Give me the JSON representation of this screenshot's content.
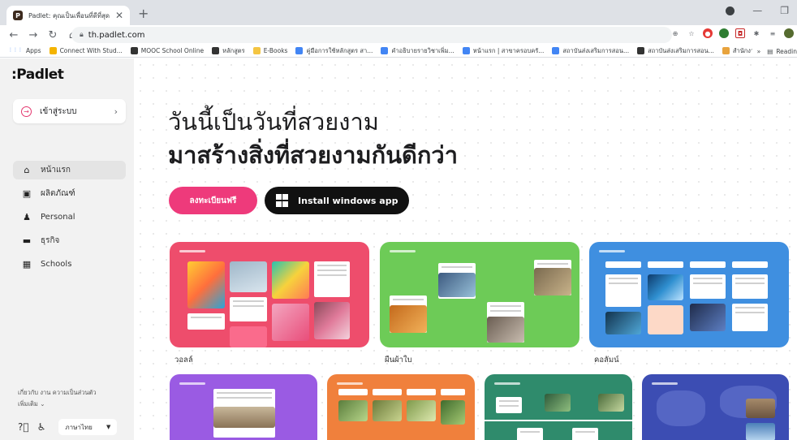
{
  "browser": {
    "tab_title": "Padlet: คุณเป็นเพื่อนที่ดีที่สุด",
    "new_tab": "+",
    "url": "th.padlet.com",
    "bookmarks": [
      {
        "label": "Apps",
        "color": "#4285f4"
      },
      {
        "label": "Connect With Stud...",
        "color": "#f4b400"
      },
      {
        "label": "MOOC School Online",
        "color": "#333333"
      },
      {
        "label": "หลักสูตร",
        "color": "#333333"
      },
      {
        "label": "E-Books",
        "color": "#f4c542"
      },
      {
        "label": "คู่มือการใช้หลักสูตร สา...",
        "color": "#4285f4"
      },
      {
        "label": "คำอธิบายรายวิชาเพิ่ม...",
        "color": "#4285f4"
      },
      {
        "label": "หน้าแรก | สาขาครอบครั...",
        "color": "#4285f4"
      },
      {
        "label": "สถาบันส่งเสริมการสอน...",
        "color": "#4285f4"
      },
      {
        "label": "สถาบันส่งเสริมการสอน...",
        "color": "#333333"
      },
      {
        "label": "สำนักงานวิชาการและ...",
        "color": "#e8a33d"
      }
    ],
    "bookmarks_more": "»",
    "reading_list": "Readin"
  },
  "sidebar": {
    "logo": ":Padlet",
    "login_label": "เข้าสู่ระบบ",
    "nav": [
      {
        "label": "หน้าแรก",
        "icon": "home-icon",
        "glyph": "⌂",
        "active": true
      },
      {
        "label": "ผลิตภัณฑ์",
        "icon": "school-hat-icon",
        "glyph": "▣",
        "active": false
      },
      {
        "label": "Personal",
        "icon": "person-icon",
        "glyph": "♟",
        "active": false
      },
      {
        "label": "ธุรกิจ",
        "icon": "briefcase-icon",
        "glyph": "▬",
        "active": false
      },
      {
        "label": "Schools",
        "icon": "schools-icon",
        "glyph": "▦",
        "active": false
      }
    ],
    "footer_links": "เกี่ยวกับ   งาน   ความเป็นส่วนตัว",
    "footer_more": "เพิ่มเติม ⌄",
    "language": "ภาษาไทย"
  },
  "main": {
    "hero_line1": "วันนี้เป็นวันที่สวยงาม",
    "hero_line2": "มาสร้างสิ่งที่สวยงามกันดีกว่า",
    "signup_label": "ลงทะเบียนฟรี",
    "install_label": "Install windows app",
    "cards": [
      {
        "label": "วอลล์",
        "color": "#ee4d6c"
      },
      {
        "label": "ผืนผ้าใบ",
        "color": "#6dcb57"
      },
      {
        "label": "คอลัมน์",
        "color": "#3f8fe0"
      },
      {
        "label": "",
        "color": "#9a5be3"
      },
      {
        "label": "",
        "color": "#f0803c"
      },
      {
        "label": "",
        "color": "#2f8b6c"
      },
      {
        "label": "",
        "color": "#3c4db3"
      }
    ]
  }
}
